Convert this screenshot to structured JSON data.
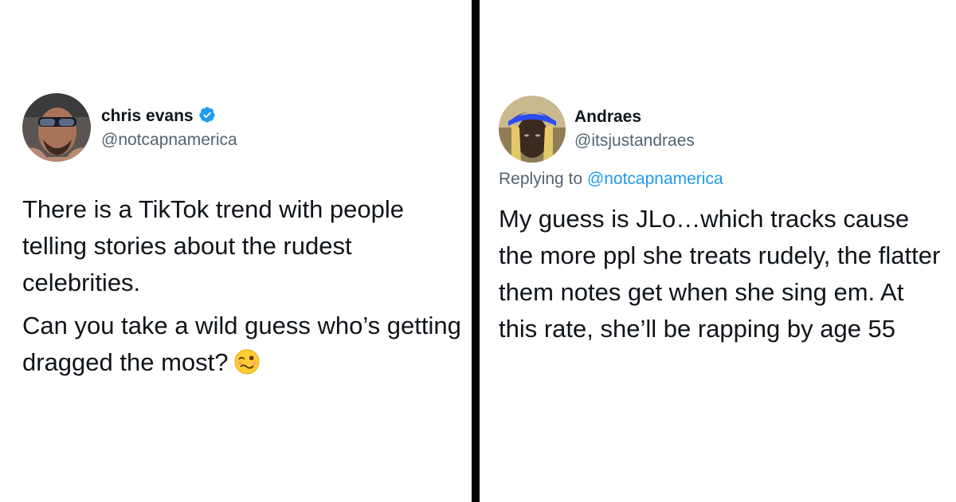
{
  "left_tweet": {
    "author_name": "chris evans",
    "author_handle": "@notcapnamerica",
    "paragraph_1": "There is a TikTok trend with people telling stories about the rudest celebrities.",
    "paragraph_2": "Can you take a wild guess who’s getting dragged the most?",
    "verified_icon": "verified-badge-icon",
    "emoji_icon": "woozy-face-emoji"
  },
  "right_tweet": {
    "author_name": "Andraes",
    "author_handle": "@itsjustandraes",
    "replying_to_prefix": "Replying to",
    "replying_to_handle": "@notcapnamerica",
    "text": "My guess is JLo…which tracks cause the more ppl she treats rudely, the flatter them notes get when she sing em. At this rate, she’ll be rapping by age 55"
  },
  "colors": {
    "text": "#0f1419",
    "secondary": "#536471",
    "link": "#1d9bf0",
    "divider": "#000000"
  }
}
